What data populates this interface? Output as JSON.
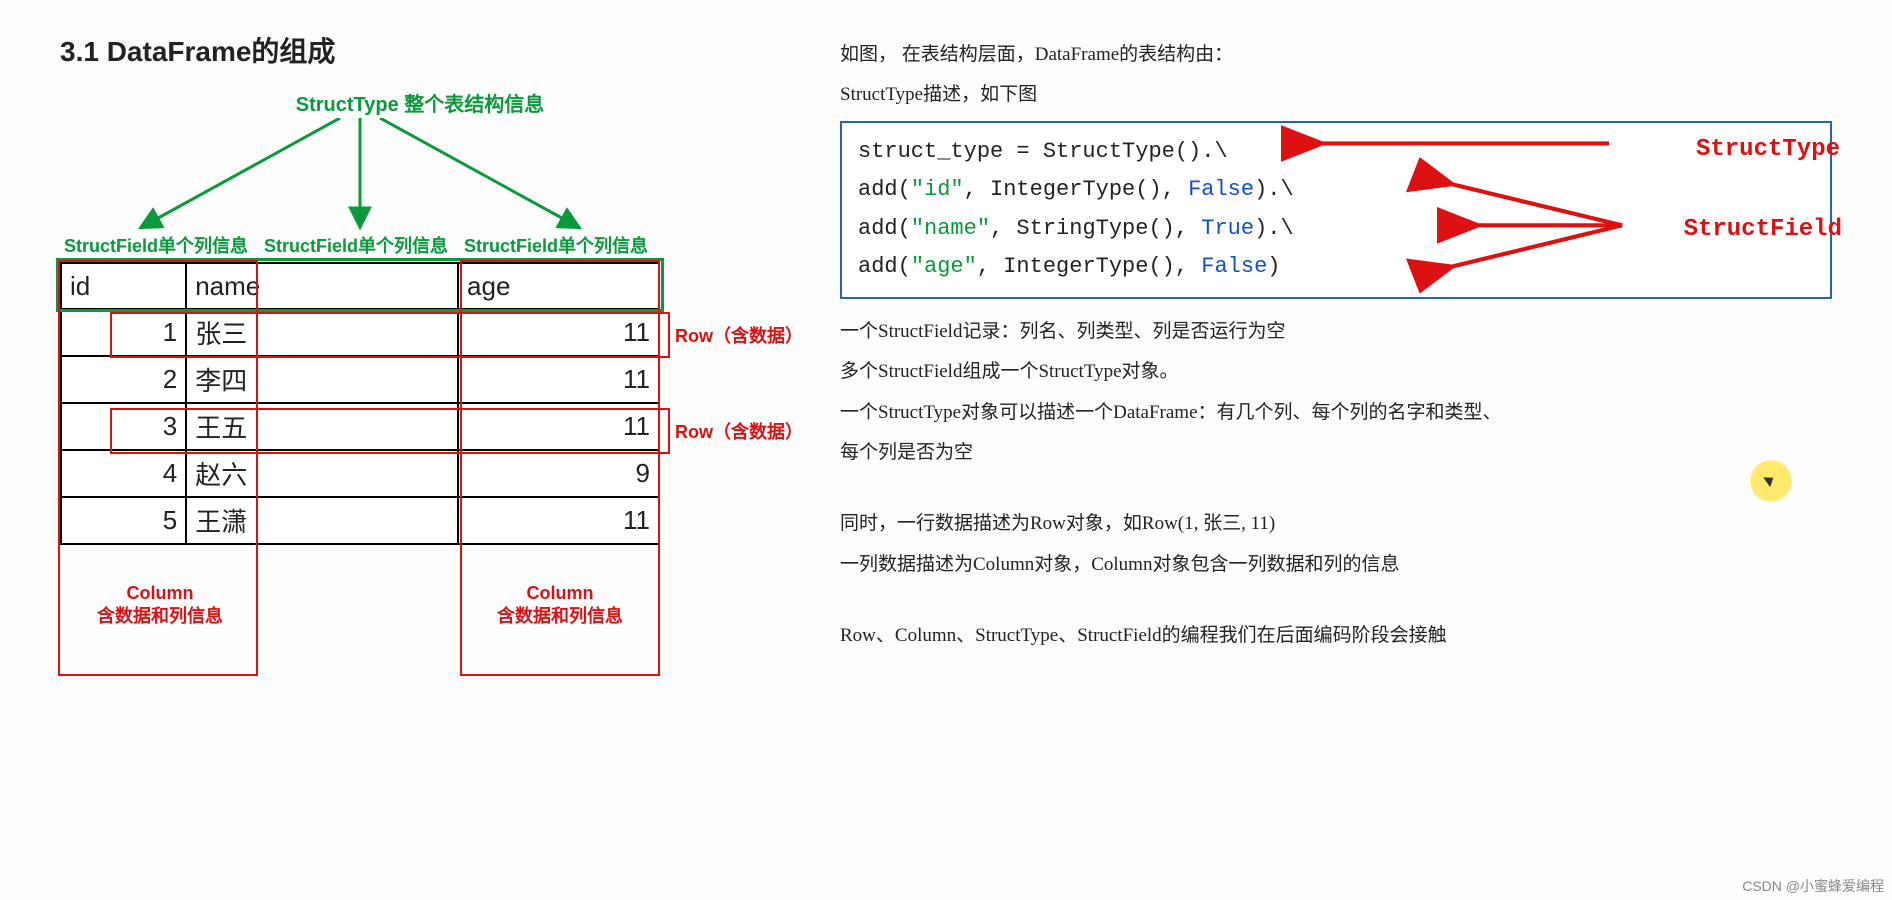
{
  "title": "3.1 DataFrame的组成",
  "diagram": {
    "top_label": "StructType 整个表结构信息",
    "structfield_label": "StructField单个列信息",
    "header": {
      "col0": "id",
      "col1": "name",
      "col2": "age"
    },
    "rows": [
      {
        "id": "1",
        "name": "张三",
        "age": "11"
      },
      {
        "id": "2",
        "name": "李四",
        "age": "11"
      },
      {
        "id": "3",
        "name": "王五",
        "age": "11"
      },
      {
        "id": "4",
        "name": "赵六",
        "age": "9"
      },
      {
        "id": "5",
        "name": "王潇",
        "age": "11"
      }
    ],
    "row_label": "Row（含数据）",
    "col_label_title": "Column",
    "col_label_sub": "含数据和列信息"
  },
  "right": {
    "p1": "如图，  在表结构层面，DataFrame的表结构由：",
    "p2": "StructType描述，如下图",
    "code": {
      "l1a": "struct_type = StructType().\\",
      "l2a": "    add(",
      "l2s": "\"id\"",
      "l2b": ", IntegerType(), ",
      "l2k": "False",
      "l2c": ").\\",
      "l3a": "    add(",
      "l3s": "\"name\"",
      "l3b": ", StringType(), ",
      "l3k": "True",
      "l3c": ").\\",
      "l4a": "    add(",
      "l4s": "\"age\"",
      "l4b": ", IntegerType(), ",
      "l4k": "False",
      "l4c": ")",
      "annot_structtype": "StructType",
      "annot_structfield": "StructField"
    },
    "p3": "一个StructField记录：列名、列类型、列是否运行为空",
    "p4": "多个StructField组成一个StructType对象。",
    "p5": "一个StructType对象可以描述一个DataFrame：有几个列、每个列的名字和类型、",
    "p6": "每个列是否为空",
    "p7": "同时，一行数据描述为Row对象，如Row(1, 张三, 11)",
    "p8": "一列数据描述为Column对象，Column对象包含一列数据和列的信息",
    "p9": "Row、Column、StructType、StructField的编程我们在后面编码阶段会接触"
  },
  "watermark": "CSDN @小蜜蜂爱编程"
}
